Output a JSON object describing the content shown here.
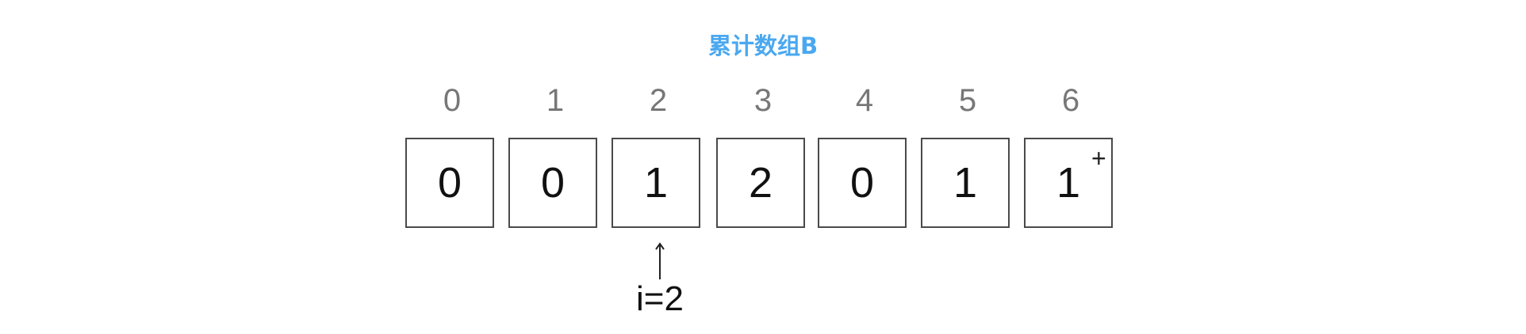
{
  "title": "累计数组B",
  "array": {
    "indices": [
      "0",
      "1",
      "2",
      "3",
      "4",
      "5",
      "6"
    ],
    "values": [
      "0",
      "0",
      "1",
      "2",
      "0",
      "1",
      "1"
    ],
    "increment_marker": {
      "at_index": 6,
      "symbol": "+"
    }
  },
  "pointer": {
    "at_index": 2,
    "label": "i=2"
  },
  "colors": {
    "title": "#4aa8f0",
    "index_text": "#777777",
    "cell_border": "#4a4a4a",
    "cell_text": "#111111"
  }
}
